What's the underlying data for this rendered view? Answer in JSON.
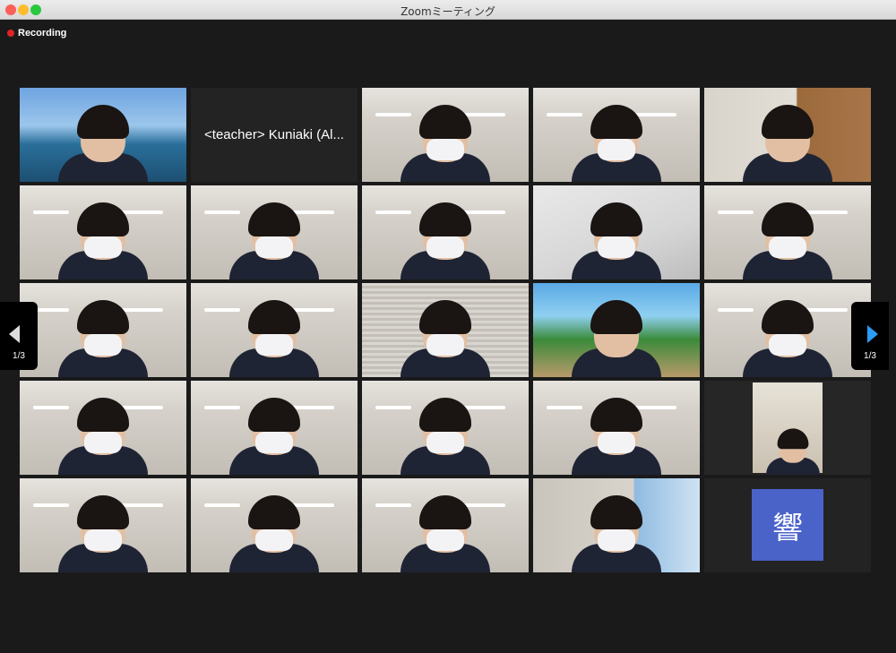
{
  "window": {
    "title": "Zoomミーティング"
  },
  "recording": {
    "label": "Recording"
  },
  "participants": [
    {
      "name": "participant-1",
      "kind": "video",
      "scene": "beach"
    },
    {
      "name": "participant-2",
      "kind": "name",
      "label": "<teacher> Kuniaki (Al..."
    },
    {
      "name": "participant-3",
      "kind": "video",
      "scene": "classroom"
    },
    {
      "name": "participant-4",
      "kind": "video",
      "scene": "classroom"
    },
    {
      "name": "participant-5",
      "kind": "video",
      "scene": "room"
    },
    {
      "name": "participant-6",
      "kind": "video",
      "scene": "classroom"
    },
    {
      "name": "participant-7",
      "kind": "video",
      "scene": "classroom"
    },
    {
      "name": "participant-8",
      "kind": "video",
      "scene": "classroom"
    },
    {
      "name": "participant-9",
      "kind": "video",
      "scene": "ceiling"
    },
    {
      "name": "participant-10",
      "kind": "video",
      "scene": "classroom"
    },
    {
      "name": "participant-11",
      "kind": "video",
      "scene": "classroom"
    },
    {
      "name": "participant-12",
      "kind": "video",
      "scene": "classroom"
    },
    {
      "name": "participant-13",
      "kind": "video",
      "scene": "blinds"
    },
    {
      "name": "participant-14",
      "kind": "video",
      "scene": "iloilo",
      "speaking": true
    },
    {
      "name": "participant-15",
      "kind": "video",
      "scene": "classroom"
    },
    {
      "name": "participant-16",
      "kind": "video",
      "scene": "classroom"
    },
    {
      "name": "participant-17",
      "kind": "video",
      "scene": "classroom"
    },
    {
      "name": "participant-18",
      "kind": "video",
      "scene": "classroom"
    },
    {
      "name": "participant-19",
      "kind": "video",
      "scene": "classroom"
    },
    {
      "name": "participant-20",
      "kind": "video",
      "scene": "small"
    },
    {
      "name": "participant-21",
      "kind": "video",
      "scene": "classroom"
    },
    {
      "name": "participant-22",
      "kind": "video",
      "scene": "classroom"
    },
    {
      "name": "participant-23",
      "kind": "video",
      "scene": "classroom"
    },
    {
      "name": "participant-24",
      "kind": "video",
      "scene": "window"
    },
    {
      "name": "participant-25",
      "kind": "avatar",
      "label": "響"
    }
  ],
  "pager": {
    "left_label": "1/3",
    "right_label": "1/3"
  },
  "colors": {
    "speaking_border": "#c7e84a",
    "avatar_bg": "#4a63c9",
    "next_arrow": "#2a9cf5"
  }
}
